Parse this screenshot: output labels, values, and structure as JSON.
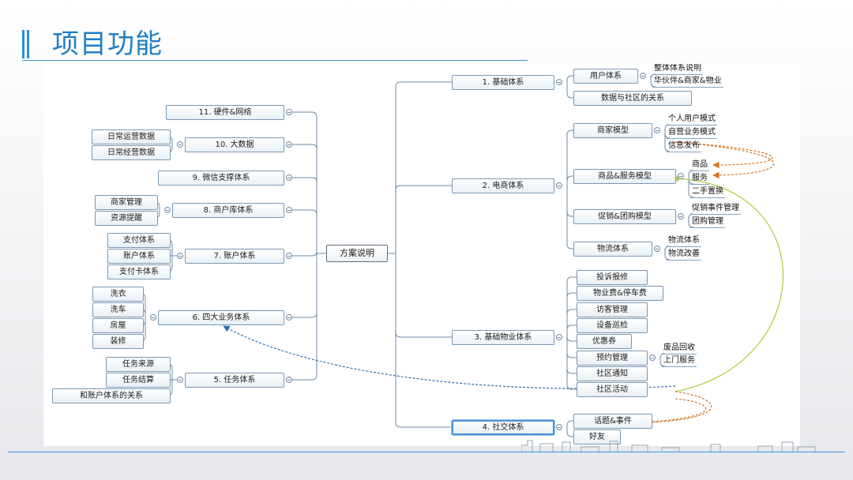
{
  "header": {
    "title": "项目功能"
  },
  "mindmap": {
    "center": "方案说明",
    "right": [
      {
        "label": "1. 基础体系",
        "children": [
          {
            "label": "用户体系",
            "children": [
              "整体体系说明",
              "华伙伴&商家&物业"
            ]
          },
          {
            "label": "数据与社区的关系"
          }
        ]
      },
      {
        "label": "2. 电商体系",
        "children": [
          {
            "label": "商家模型",
            "children": [
              "个人用户模式",
              "自营业务模式",
              "信息发布"
            ]
          },
          {
            "label": "商品&服务模型",
            "children": [
              "商品",
              "服务",
              "二手置换"
            ]
          },
          {
            "label": "促销&团购模型",
            "children": [
              "促销事件管理",
              "团购管理"
            ]
          },
          {
            "label": "物流体系",
            "children": [
              "物流体系",
              "物流改善"
            ]
          }
        ]
      },
      {
        "label": "3. 基础物业体系",
        "children": [
          {
            "label": "投诉报修"
          },
          {
            "label": "物业费&停车费"
          },
          {
            "label": "访客管理"
          },
          {
            "label": "设备巡检"
          },
          {
            "label": "优惠券"
          },
          {
            "label": "预约管理",
            "children": [
              "废品回收",
              "上门服务"
            ]
          },
          {
            "label": "社区通知"
          },
          {
            "label": "社区活动"
          }
        ]
      },
      {
        "label": "4. 社交体系",
        "children": [
          {
            "label": "话题&事件"
          },
          {
            "label": "好友"
          }
        ]
      }
    ],
    "left": [
      {
        "label": "11. 硬件&网络",
        "children": []
      },
      {
        "label": "10. 大数据",
        "children": [
          "日常运营数据",
          "日常经营数据"
        ]
      },
      {
        "label": "9. 微信支撑体系",
        "children": []
      },
      {
        "label": "8. 商户库体系",
        "children": [
          "商家管理",
          "资源提醒"
        ]
      },
      {
        "label": "7. 账户体系",
        "children": [
          "支付体系",
          "账户体系",
          "支付卡体系"
        ]
      },
      {
        "label": "6. 四大业务体系",
        "children": [
          "洗衣",
          "洗车",
          "房屋",
          "装修"
        ]
      },
      {
        "label": "5. 任务体系",
        "children": [
          "任务来源",
          "任务结算",
          "和账户体系的关系"
        ]
      }
    ]
  },
  "colors": {
    "title": "#1f7fc4",
    "accent_line": "#3b9ad8",
    "connector": "#6f8aa5",
    "relation_orange": "#d8731f",
    "relation_green": "#a8cf3a",
    "relation_blue": "#2f6fb0"
  }
}
